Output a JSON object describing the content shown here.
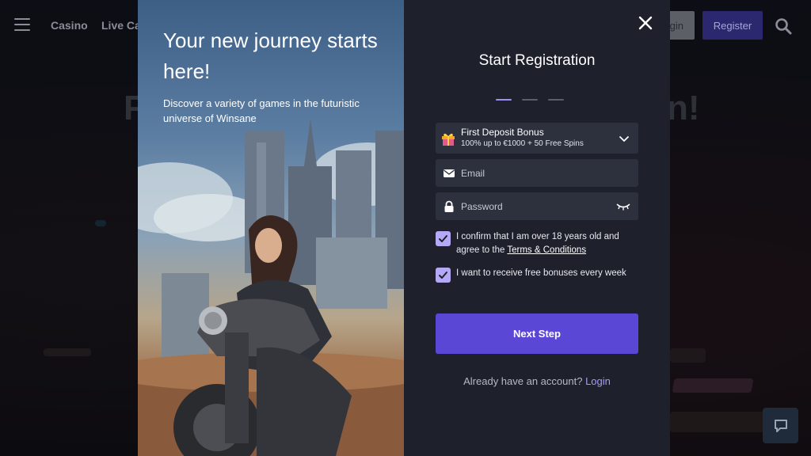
{
  "background": {
    "nav": {
      "casino": "Casino",
      "live_casino": "Live Ca"
    },
    "login_label": "gin",
    "register_label": "Register",
    "headline_left": "F",
    "headline_right": "n!"
  },
  "modal": {
    "promo": {
      "title": "Your new journey starts here!",
      "subtitle": "Discover a variety of games in the futuristic universe of Winsane"
    },
    "form": {
      "title": "Start Registration",
      "steps": [
        true,
        false,
        false
      ],
      "bonus": {
        "title": "First Deposit Bonus",
        "description": "100% up to €1000 + 50 Free Spins"
      },
      "email_placeholder": "Email",
      "password_placeholder": "Password",
      "age_confirm_text": "I confirm that I am over 18 years old and agree to the ",
      "terms_link": "Terms & Conditions",
      "bonuses_text": "I want to receive free bonuses every week",
      "next_label": "Next Step",
      "account_question": "Already have an account?",
      "login_link": "Login"
    }
  },
  "colors": {
    "panel": "#1e212c",
    "field": "#2d303d",
    "accent": "#5a47d6",
    "checkbox": "#b3a9f7"
  }
}
